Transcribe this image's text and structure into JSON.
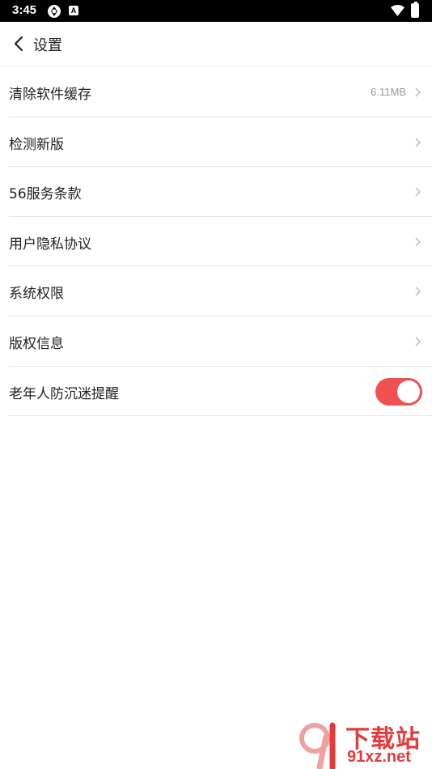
{
  "status_bar": {
    "time": "3:45",
    "icons": [
      "sync-icon",
      "a-icon",
      "wifi-icon",
      "battery-icon"
    ],
    "a_icon_letter": "A"
  },
  "header": {
    "title": "设置",
    "back_icon": "chevron-left-icon"
  },
  "settings": {
    "items": [
      {
        "label": "清除软件缓存",
        "value": "6.11MB"
      },
      {
        "label": "检测新版"
      },
      {
        "label": "56服务条款"
      },
      {
        "label": "用户隐私协议"
      },
      {
        "label": "系统权限"
      },
      {
        "label": "版权信息"
      },
      {
        "label": "老年人防沉迷提醒",
        "toggle_on": true
      }
    ]
  },
  "watermark": {
    "logo_text": "91",
    "title": "下载站",
    "subtitle": "91xz.net"
  },
  "colors": {
    "accent": "#f05050",
    "divider": "#e6e6e6",
    "secondary_text": "#999999"
  }
}
